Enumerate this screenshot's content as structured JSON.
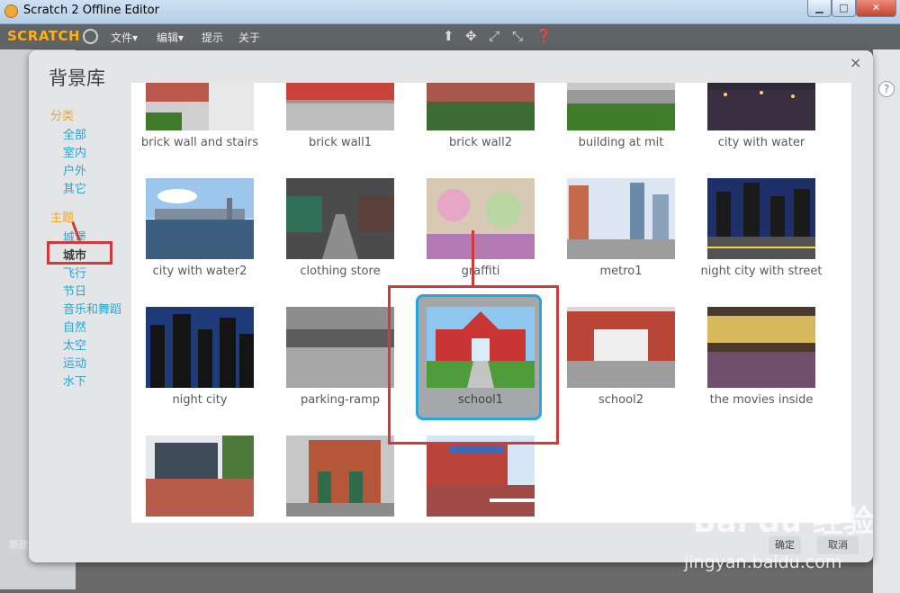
{
  "window": {
    "title": "Scratch 2 Offline Editor",
    "minimize": "▁",
    "maximize": "□",
    "close": "✕"
  },
  "menubar": {
    "logo": "SCRATCH",
    "items": [
      "文件▾",
      "编辑▾",
      "提示",
      "关于"
    ],
    "tool_icons": [
      "stamp-icon",
      "move-icon",
      "grow-icon",
      "shrink-icon",
      "help-icon"
    ]
  },
  "editor": {
    "new_label": "新建"
  },
  "dialog": {
    "title": "背景库",
    "close": "×",
    "category_heading": "分类",
    "categories": [
      "全部",
      "室内",
      "户外",
      "其它"
    ],
    "theme_heading": "主题",
    "themes": [
      "城堡",
      "城市",
      "飞行",
      "节日",
      "音乐和舞蹈",
      "自然",
      "太空",
      "运动",
      "水下"
    ],
    "selected_theme": "城市",
    "ok_label": "确定",
    "cancel_label": "取消",
    "backdrops": [
      "brick wall and stairs",
      "brick wall1",
      "brick wall2",
      "building at mit",
      "city with water",
      "city with water2",
      "clothing store",
      "graffiti",
      "metro1",
      "night city with street",
      "night city",
      "parking-ramp",
      "school1",
      "school2",
      "the movies inside",
      "",
      "",
      ""
    ],
    "selected_backdrop": "school1"
  },
  "watermark": {
    "text": "Bai du 经验",
    "sub": "jingyan.baidu.com"
  },
  "colors": {
    "accent": "#27a5d9",
    "heading": "#f1a62d",
    "highlight": "#d23a3a",
    "selection": "#29a6dd"
  }
}
